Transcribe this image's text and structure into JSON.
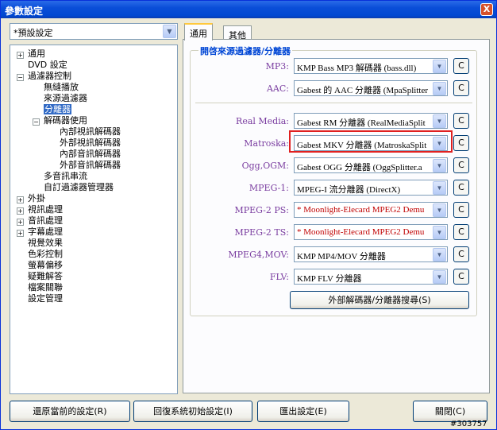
{
  "window": {
    "title": "參數設定",
    "close_glyph": "X"
  },
  "preset": {
    "value": "*預設設定"
  },
  "tree": {
    "items": [
      {
        "label": "通用"
      },
      {
        "label": "DVD 設定"
      },
      {
        "label": "過濾器控制"
      },
      {
        "label": "無縫播放"
      },
      {
        "label": "來源過濾器"
      },
      {
        "label": "分離器"
      },
      {
        "label": "解碼器使用"
      },
      {
        "label": "內部視訊解碼器"
      },
      {
        "label": "外部視訊解碼器"
      },
      {
        "label": "內部音訊解碼器"
      },
      {
        "label": "外部音訊解碼器"
      },
      {
        "label": "多音訊串流"
      },
      {
        "label": "自訂過濾器管理器"
      },
      {
        "label": "外掛"
      },
      {
        "label": "視訊處理"
      },
      {
        "label": "音訊處理"
      },
      {
        "label": "字幕處理"
      },
      {
        "label": "視覺效果"
      },
      {
        "label": "色彩控制"
      },
      {
        "label": "螢幕偏移"
      },
      {
        "label": "疑難解答"
      },
      {
        "label": "檔案關聯"
      },
      {
        "label": "設定管理"
      }
    ]
  },
  "tabs": [
    {
      "label": "通用"
    },
    {
      "label": "其他"
    }
  ],
  "group": {
    "title": "開啓來源過濾器/分離器"
  },
  "rows": [
    {
      "label": "MP3:",
      "value": "KMP Bass MP3 解碼器 (bass.dll)",
      "c": "C"
    },
    {
      "label": "AAC:",
      "value": "Gabest 的 AAC 分離器 (MpaSplitter",
      "c": "C"
    },
    {
      "label": "Real Media:",
      "value": "Gabest RM 分離器 (RealMediaSplit",
      "c": "C"
    },
    {
      "label": "Matroska:",
      "value": "Gabest MKV 分離器 (MatroskaSplit",
      "c": "C"
    },
    {
      "label": "Ogg,OGM:",
      "value": "Gabest OGG 分離器 (OggSplitter.a",
      "c": "C"
    },
    {
      "label": "MPEG-1:",
      "value": "MPEG-I 流分離器 (DirectX)",
      "c": "C"
    },
    {
      "label": "MPEG-2 PS:",
      "value": "* Moonlight-Elecard MPEG2 Demu",
      "c": "C"
    },
    {
      "label": "MPEG-2 TS:",
      "value": "* Moonlight-Elecard MPEG2 Demu",
      "c": "C"
    },
    {
      "label": "MPEG4,MOV:",
      "value": "KMP MP4/MOV 分離器",
      "c": "C"
    },
    {
      "label": "FLV:",
      "value": "KMP FLV 分離器",
      "c": "C"
    }
  ],
  "search_button": {
    "label": "外部解碼器/分離器搜尋(S)"
  },
  "footer": {
    "restore": "還原當前的設定(R)",
    "reset": "回復系統初始設定(I)",
    "export": "匯出設定(E)",
    "close": "關閉(C)"
  },
  "watermark": "#303757",
  "colors": {
    "highlight": "#E02020",
    "special_value": "#C00000",
    "group_title": "#0046D5"
  }
}
